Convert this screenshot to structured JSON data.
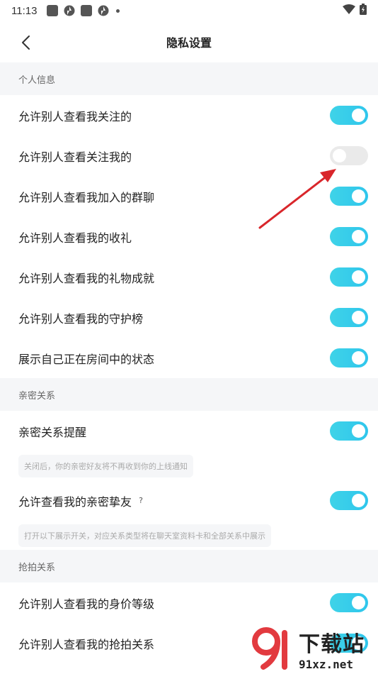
{
  "status_bar": {
    "time": "11:13"
  },
  "header": {
    "title": "隐私设置"
  },
  "sections": {
    "personal": {
      "title": "个人信息",
      "items": [
        {
          "label": "允许别人查看我关注的",
          "on": true
        },
        {
          "label": "允许别人查看关注我的",
          "on": false
        },
        {
          "label": "允许别人查看我加入的群聊",
          "on": true
        },
        {
          "label": "允许别人查看我的收礼",
          "on": true
        },
        {
          "label": "允许别人查看我的礼物成就",
          "on": true
        },
        {
          "label": "允许别人查看我的守护榜",
          "on": true
        },
        {
          "label": "展示自己正在房间中的状态",
          "on": true
        }
      ]
    },
    "intimate": {
      "title": "亲密关系",
      "reminder": {
        "label": "亲密关系提醒",
        "on": true
      },
      "reminder_hint": "关闭后，你的亲密好友将不再收到你的上线通知",
      "friends": {
        "label": "允许查看我的亲密挚友",
        "help": "?",
        "on": true
      },
      "friends_hint": "打开以下展示开关，对应关系类型将在聊天室资料卡和全部关系中展示"
    },
    "grab": {
      "title": "抢拍关系",
      "items": [
        {
          "label": "允许别人查看我的身价等级",
          "on": true
        },
        {
          "label": "允许别人查看我的抢拍关系",
          "on": true
        }
      ]
    }
  },
  "watermark": {
    "cn": "下载站",
    "url": "91xz.net"
  },
  "colors": {
    "toggle_on": "#2fc6ec",
    "toggle_off": "#eaeaea",
    "arrow": "#d9262b",
    "section_bg": "#f5f6f8"
  }
}
